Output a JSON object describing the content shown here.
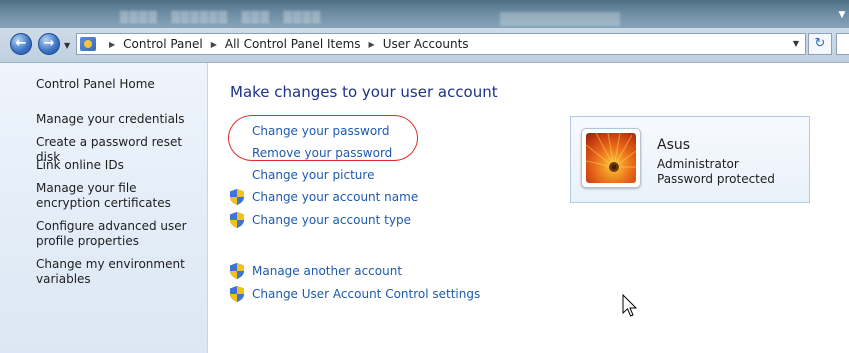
{
  "address_bar": {
    "breadcrumbs": [
      "Control Panel",
      "All Control Panel Items",
      "User Accounts"
    ]
  },
  "left_pane": {
    "home_link": "Control Panel Home",
    "links": [
      "Manage your credentials",
      "Create a password reset disk",
      "Link online IDs",
      "Manage your file encryption certificates",
      "Configure advanced user profile properties",
      "Change my environment variables"
    ]
  },
  "main": {
    "title": "Make changes to your user account",
    "tasks": [
      {
        "label": "Change your password",
        "shield": false
      },
      {
        "label": "Remove your password",
        "shield": false
      },
      {
        "label": "Change your picture",
        "shield": false
      },
      {
        "label": "Change your account name",
        "shield": true
      },
      {
        "label": "Change your account type",
        "shield": true
      }
    ],
    "other_tasks": [
      {
        "label": "Manage another account",
        "shield": true
      },
      {
        "label": "Change User Account Control settings",
        "shield": true
      }
    ]
  },
  "account": {
    "name": "Asus",
    "role": "Administrator",
    "status": "Password protected"
  },
  "icons": {
    "back": "back-arrow-icon",
    "forward": "forward-arrow-icon",
    "shield": "uac-shield-icon",
    "refresh": "refresh-icon",
    "control_panel": "control-panel-icon"
  },
  "colors": {
    "link": "#1e5aaf",
    "title": "#1e3287",
    "highlight": "#e02b2b",
    "left_pane_bg": "#dbe7f4"
  }
}
